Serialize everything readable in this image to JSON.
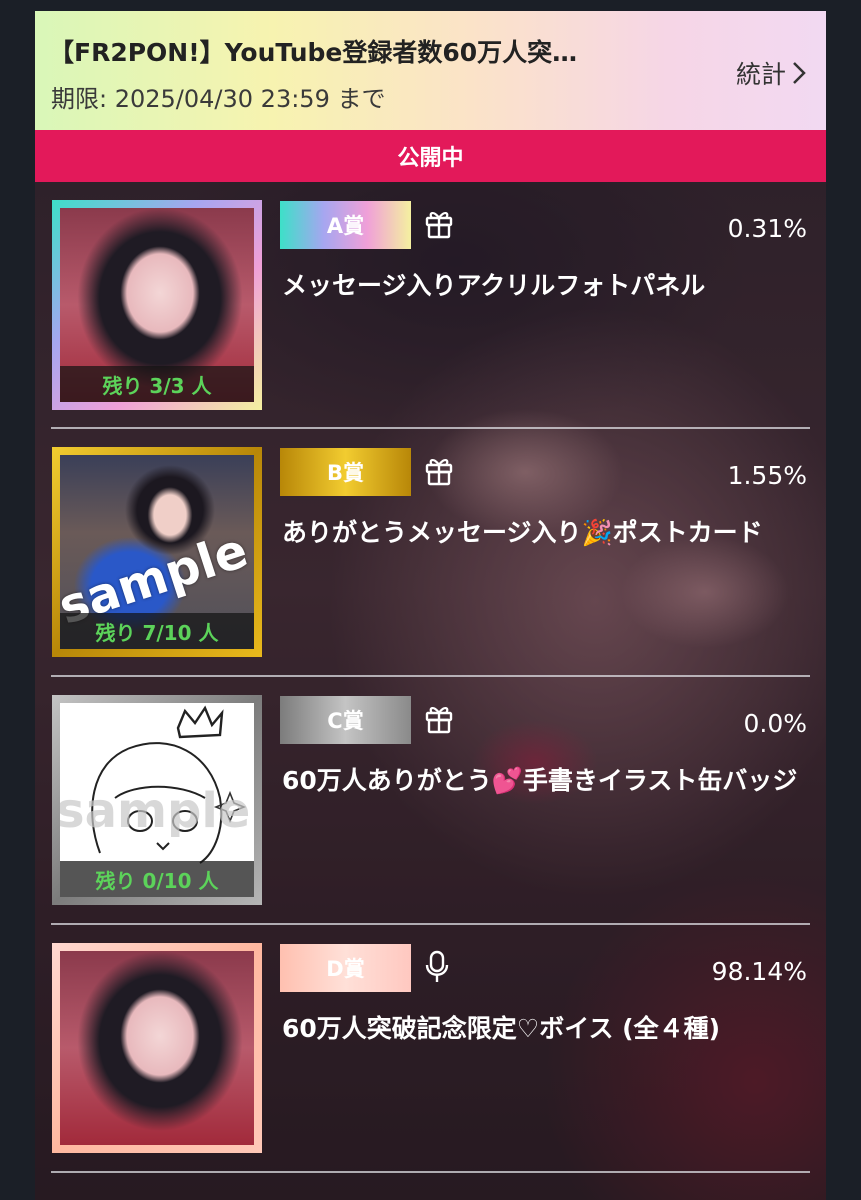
{
  "header": {
    "title": "【FR2PON!】YouTube登録者数60万人突…",
    "deadline": "期限: 2025/04/30 23:59 まで",
    "stats_label": "統計"
  },
  "status": {
    "label": "公開中"
  },
  "prizes": [
    {
      "rank": "A賞",
      "type_icon": "gift-icon",
      "percent": "0.31%",
      "name": "メッセージ入りアクリルフォトパネル",
      "remaining": "残り 3/3 人",
      "remaining_fraction": 1.0,
      "rank_colors": [
        "#3de0c8",
        "#a6a6f0",
        "#f0a0d8",
        "#f4f0a0"
      ]
    },
    {
      "rank": "B賞",
      "type_icon": "gift-icon",
      "percent": "1.55%",
      "name": "ありがとうメッセージ入り🎉ポストカード",
      "remaining": "残り 7/10 人",
      "remaining_fraction": 0.7,
      "watermark": "sample",
      "rank_colors": [
        "#d7a50a",
        "#f2cc30",
        "#b88708"
      ]
    },
    {
      "rank": "C賞",
      "type_icon": "gift-icon",
      "percent": "0.0%",
      "name": "60万人ありがとう💕手書きイラスト缶バッジ",
      "remaining": "残り 0/10 人",
      "remaining_fraction": 0.0,
      "watermark": "sample",
      "rank_colors": [
        "#7c7c7c",
        "#c4c4c4",
        "#8a8a8a"
      ]
    },
    {
      "rank": "D賞",
      "type_icon": "microphone-icon",
      "percent": "98.14%",
      "name": "60万人突破記念限定♡ボイス (全４種)",
      "rank_colors": [
        "#ffc8b0",
        "#ffd8d0",
        "#ffc0b8"
      ]
    }
  ],
  "colors": {
    "accent": "#e3195a",
    "remaining_text": "#5cd35a"
  }
}
